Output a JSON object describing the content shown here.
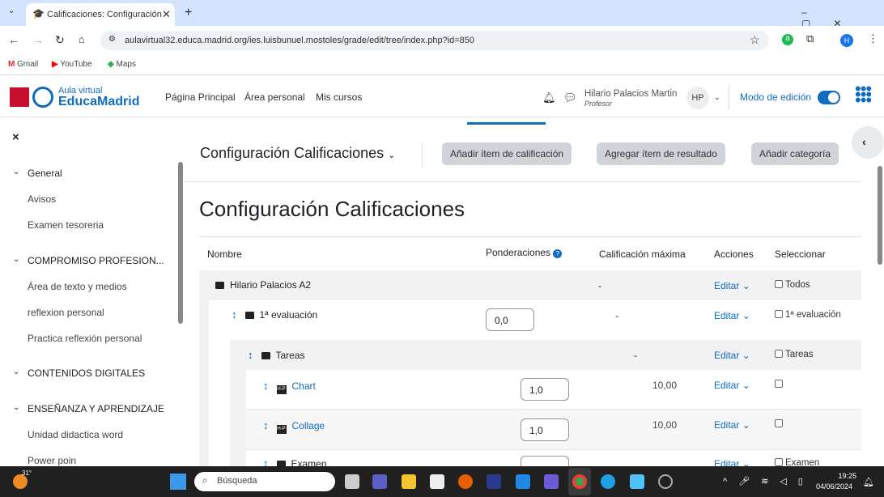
{
  "browser": {
    "tab_title": "Calificaciones: Configuración",
    "url": "aulavirtual32.educa.madrid.org/ies.luisbunuel.mostoles/grade/edit/tree/index.php?id=850",
    "profile_initial": "H",
    "bookmarks": [
      "Gmail",
      "YouTube",
      "Maps"
    ]
  },
  "header": {
    "logo_top": "Aula virtual",
    "logo_bottom": "EducaMadrid",
    "nav": [
      "Página Principal",
      "Área personal",
      "Mis cursos"
    ],
    "user_name": "Hilario Palacios Martin",
    "user_role": "Profesor",
    "avatar": "HP",
    "edit_mode_label": "Modo de edición",
    "edit_mode_on": true
  },
  "sidebar": {
    "sections": [
      {
        "title": "General",
        "items": [
          "Avisos",
          "Examen tesoreria"
        ]
      },
      {
        "title": "COMPROMISO PROFESION...",
        "items": [
          "Área de texto y medios",
          "reflexion personal",
          "Practica reflexión personal"
        ]
      },
      {
        "title": "CONTENIDOS DIGITALES",
        "items": []
      },
      {
        "title": "ENSEÑANZA Y APRENDIZAJE",
        "items": [
          "Unidad didactica word",
          "Power poin"
        ]
      }
    ]
  },
  "toolbar": {
    "selector": "Configuración Calificaciones",
    "buttons": [
      "Añadir ítem de calificación",
      "Agregar ítem de resultado",
      "Añadir categoría"
    ]
  },
  "page_title": "Configuración Calificaciones",
  "table": {
    "headers": [
      "Nombre",
      "Ponderaciones",
      "Calificación máxima",
      "Acciones",
      "Seleccionar"
    ],
    "rows": [
      {
        "name": "Hilario Palacios A2",
        "weight": "",
        "max": "-",
        "action": "Editar",
        "select": "Todos"
      },
      {
        "name": "1ª evaluación",
        "weight": "0,0",
        "max": "-",
        "action": "Editar",
        "select": "1ª evaluación"
      },
      {
        "name": "Tareas",
        "weight": "",
        "max": "-",
        "action": "Editar",
        "select": "Tareas"
      },
      {
        "name": "Chart",
        "weight": "1,0",
        "max": "10,00",
        "action": "Editar",
        "select": ""
      },
      {
        "name": "Collage",
        "weight": "1,0",
        "max": "10,00",
        "action": "Editar",
        "select": ""
      },
      {
        "name": "Examen",
        "weight": "",
        "max": "-",
        "action": "Editar",
        "select": "Examen"
      }
    ]
  },
  "taskbar": {
    "weather": "31°",
    "search": "Búsqueda",
    "time": "19:25",
    "date": "04/06/2024"
  }
}
